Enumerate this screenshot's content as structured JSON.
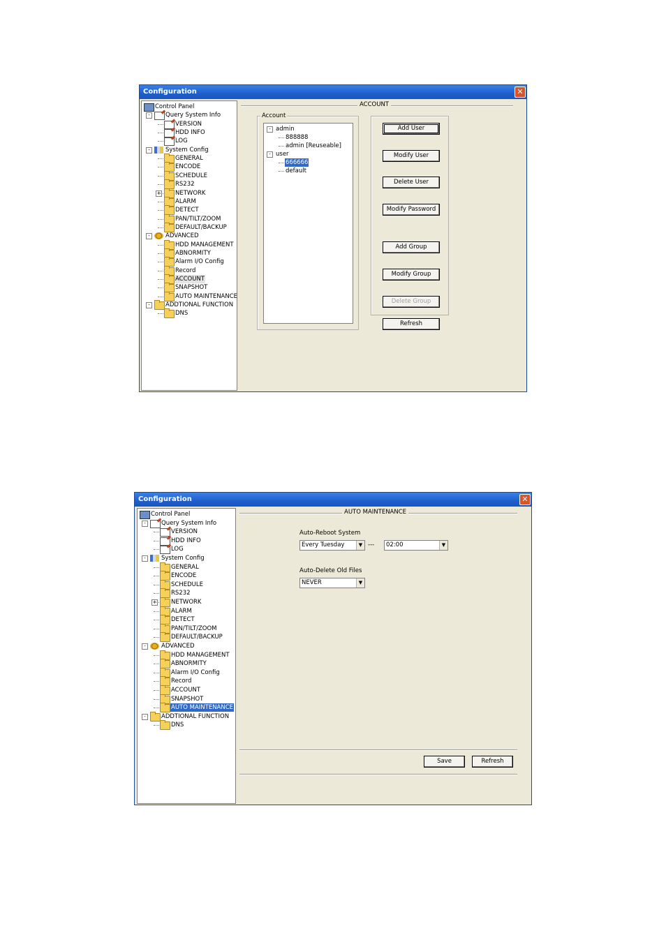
{
  "window1": {
    "title": "Configuration",
    "panel_title": "ACCOUNT",
    "tree": [
      {
        "label": "Control Panel"
      },
      {
        "label": "Query System Info"
      },
      {
        "label": "VERSION"
      },
      {
        "label": "HDD INFO"
      },
      {
        "label": "LOG"
      },
      {
        "label": "System Config"
      },
      {
        "label": "GENERAL"
      },
      {
        "label": "ENCODE"
      },
      {
        "label": "SCHEDULE"
      },
      {
        "label": "RS232"
      },
      {
        "label": "NETWORK"
      },
      {
        "label": "ALARM"
      },
      {
        "label": "DETECT"
      },
      {
        "label": "PAN/TILT/ZOOM"
      },
      {
        "label": "DEFAULT/BACKUP"
      },
      {
        "label": "ADVANCED"
      },
      {
        "label": "HDD MANAGEMENT"
      },
      {
        "label": "ABNORMITY"
      },
      {
        "label": "Alarm I/O Config"
      },
      {
        "label": "Record"
      },
      {
        "label": "ACCOUNT"
      },
      {
        "label": "SNAPSHOT"
      },
      {
        "label": "AUTO MAINTENANCE"
      },
      {
        "label": "ADDTIONAL FUNCTION"
      },
      {
        "label": "DNS"
      }
    ],
    "account_group_label": "Account",
    "accounts": [
      {
        "label": "admin"
      },
      {
        "label": "888888"
      },
      {
        "label": "admin [Reuseable]"
      },
      {
        "label": "user"
      },
      {
        "label": "666666"
      },
      {
        "label": "default"
      }
    ],
    "buttons": {
      "add_user": "Add User",
      "modify_user": "Modify User",
      "delete_user": "Delete User",
      "modify_password": "Modify Password",
      "add_group": "Add Group",
      "modify_group": "Modify Group",
      "delete_group": "Delete Group",
      "refresh": "Refresh"
    }
  },
  "window2": {
    "title": "Configuration",
    "panel_title": "AUTO MAINTENANCE",
    "tree": [
      {
        "label": "Control Panel"
      },
      {
        "label": "Query System Info"
      },
      {
        "label": "VERSION"
      },
      {
        "label": "HDD INFO"
      },
      {
        "label": "LOG"
      },
      {
        "label": "System Config"
      },
      {
        "label": "GENERAL"
      },
      {
        "label": "ENCODE"
      },
      {
        "label": "SCHEDULE"
      },
      {
        "label": "RS232"
      },
      {
        "label": "NETWORK"
      },
      {
        "label": "ALARM"
      },
      {
        "label": "DETECT"
      },
      {
        "label": "PAN/TILT/ZOOM"
      },
      {
        "label": "DEFAULT/BACKUP"
      },
      {
        "label": "ADVANCED"
      },
      {
        "label": "HDD MANAGEMENT"
      },
      {
        "label": "ABNORMITY"
      },
      {
        "label": "Alarm I/O Config"
      },
      {
        "label": "Record"
      },
      {
        "label": "ACCOUNT"
      },
      {
        "label": "SNAPSHOT"
      },
      {
        "label": "AUTO MAINTENANCE"
      },
      {
        "label": "ADDTIONAL FUNCTION"
      },
      {
        "label": "DNS"
      }
    ],
    "auto_reboot_label": "Auto-Reboot System",
    "reboot_day": "Every Tuesday",
    "separator": "---",
    "reboot_time": "02:00",
    "auto_delete_label": "Auto-Delete Old Files",
    "delete_value": "NEVER",
    "buttons": {
      "save": "Save",
      "refresh": "Refresh"
    }
  },
  "colors": {
    "titlebar": "#1f5fcc",
    "selection": "#316ac5",
    "window_bg": "#ece9d8"
  }
}
